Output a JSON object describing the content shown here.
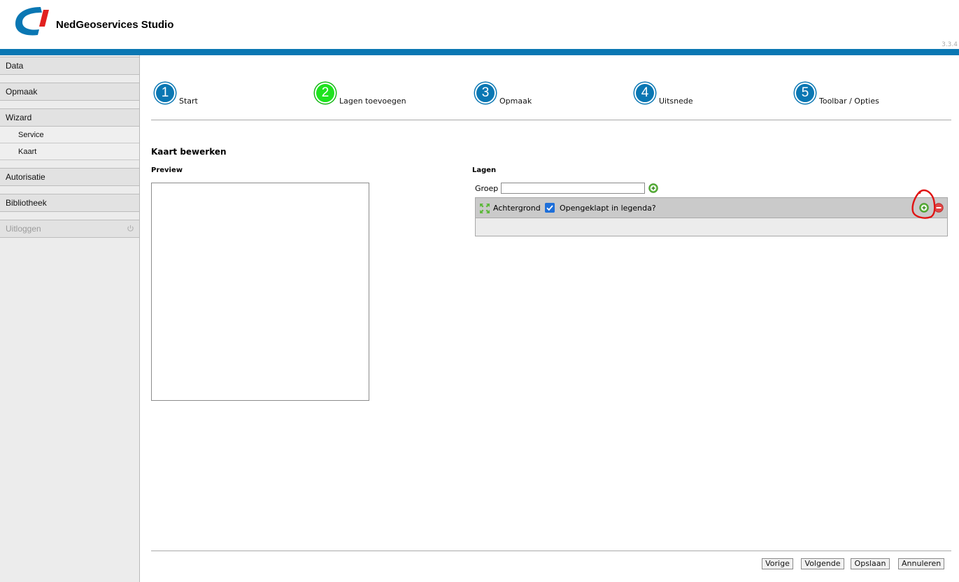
{
  "app": {
    "title": "NedGeoservices Studio",
    "version": "3.3.4"
  },
  "colors": {
    "brand_blue": "#0a77b3",
    "brand_red": "#e1201f",
    "active_step": "#1ee31e"
  },
  "sidebar": {
    "items": [
      {
        "label": "Data"
      },
      {
        "label": "Opmaak"
      },
      {
        "label": "Wizard",
        "children": [
          {
            "label": "Service"
          },
          {
            "label": "Kaart"
          }
        ]
      },
      {
        "label": "Autorisatie"
      },
      {
        "label": "Bibliotheek"
      },
      {
        "label": "Uitloggen",
        "disabled": true,
        "icon": "power-icon"
      }
    ]
  },
  "steps": [
    {
      "number": "1",
      "label": "Start"
    },
    {
      "number": "2",
      "label": "Lagen toevoegen",
      "active": true
    },
    {
      "number": "3",
      "label": "Opmaak"
    },
    {
      "number": "4",
      "label": "Uitsnede"
    },
    {
      "number": "5",
      "label": "Toolbar / Opties"
    }
  ],
  "main": {
    "title": "Kaart bewerken",
    "preview_label": "Preview",
    "lagen_label": "Lagen",
    "groep_label": "Groep",
    "groep_value": "",
    "layer": {
      "name": "Achtergrond",
      "checkbox_label": "Opengeklapt in legenda?",
      "checked": true
    }
  },
  "footer": {
    "buttons": {
      "prev": "Vorige",
      "next": "Volgende",
      "save": "Opslaan",
      "cancel": "Annuleren"
    }
  }
}
